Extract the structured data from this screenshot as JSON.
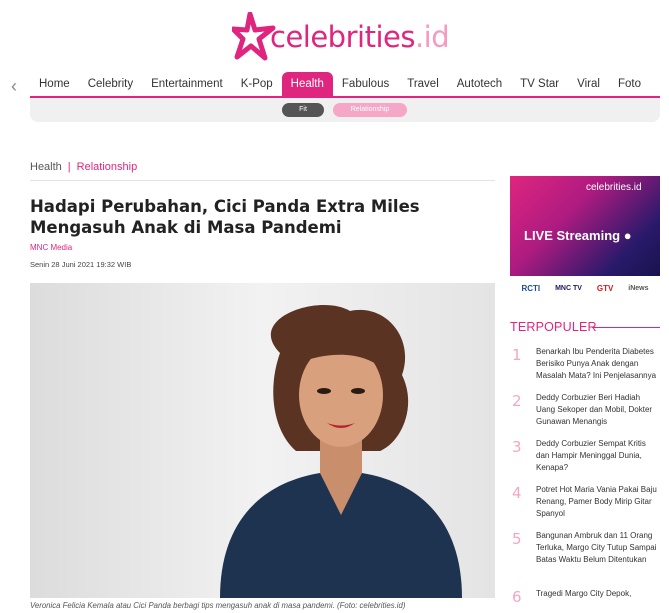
{
  "brand": {
    "name": "celebrities",
    "tld": ".id",
    "color_primary": "#e0257f",
    "color_light": "#f59ac0"
  },
  "nav": {
    "items": [
      {
        "label": "Home"
      },
      {
        "label": "Celebrity"
      },
      {
        "label": "Entertainment"
      },
      {
        "label": "K-Pop"
      },
      {
        "label": "Health",
        "active": true
      },
      {
        "label": "Fabulous"
      },
      {
        "label": "Travel"
      },
      {
        "label": "Autotech"
      },
      {
        "label": "TV Star"
      },
      {
        "label": "Viral"
      },
      {
        "label": "Foto"
      }
    ],
    "sub": {
      "fit": "Fit",
      "relationship": "Relationship"
    }
  },
  "breadcrumb": {
    "category": "Health",
    "separator": "|",
    "subcategory": "Relationship"
  },
  "article": {
    "title": "Hadapi Perubahan, Cici Panda Extra Miles Mengasuh Anak di Masa Pandemi",
    "author": "MNC Media",
    "date": "Senin 28 Juni 2021 19:32 WIB",
    "caption": "Veronica Felicia Kemala atau Cici Panda berbagi tips mengasuh anak di masa pandemi. (Foto: celebrities.id)"
  },
  "banner": {
    "logo": "celebrities.id",
    "live_text": "LIVE Streaming",
    "channels": [
      "RCTI",
      "MNC TV",
      "GTV",
      "iNews"
    ]
  },
  "terpopuler": {
    "heading": "TERPOPULER",
    "items": [
      {
        "num": "1",
        "text": "Benarkah Ibu Penderita Diabetes Berisiko Punya Anak dengan Masalah Mata? Ini Penjelasannya"
      },
      {
        "num": "2",
        "text": "Deddy Corbuzier Beri Hadiah Uang Sekoper dan Mobil, Dokter Gunawan Menangis"
      },
      {
        "num": "3",
        "text": "Deddy Corbuzier Sempat Kritis dan Hampir Meninggal Dunia, Kenapa?"
      },
      {
        "num": "4",
        "text": "Potret Hot Maria Vania Pakai Baju Renang, Pamer Body Mirip Gitar Spanyol"
      },
      {
        "num": "5",
        "text": "Bangunan Ambruk dan 11 Orang Terluka, Margo City Tutup Sampai Batas Waktu Belum Ditentukan"
      },
      {
        "num": "6",
        "text": "Tragedi Margo City Depok,"
      }
    ]
  }
}
